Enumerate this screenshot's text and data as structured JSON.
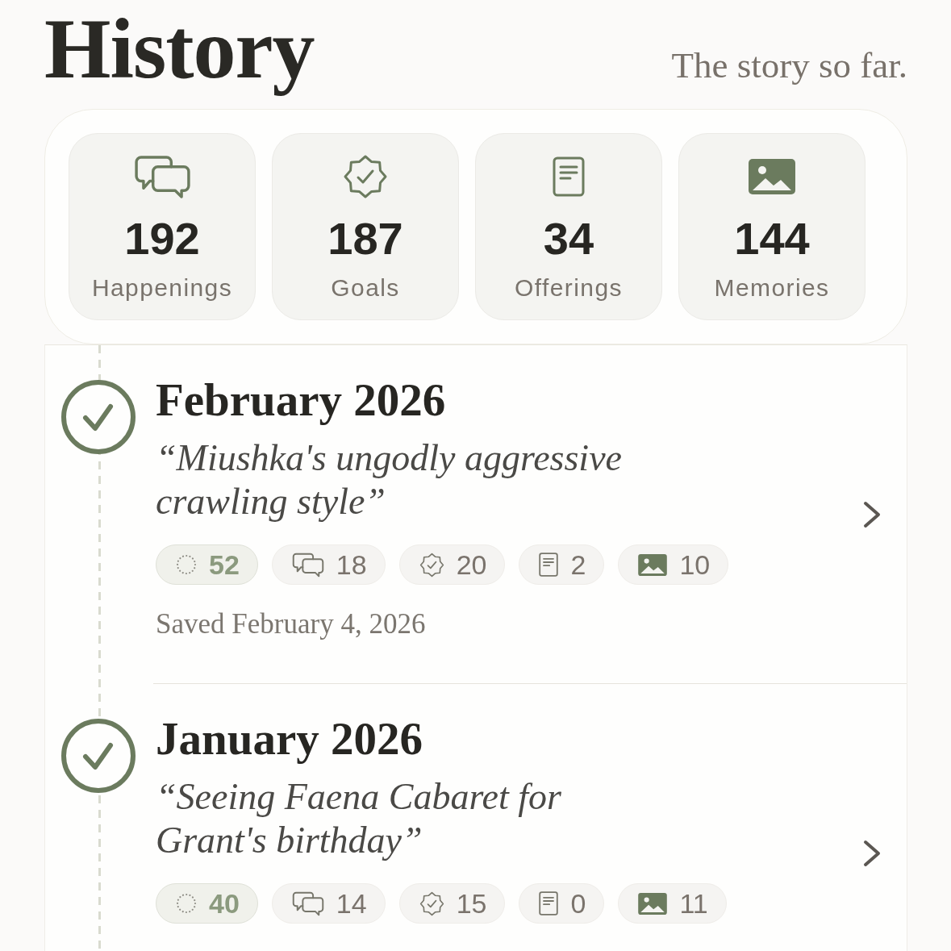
{
  "header": {
    "title": "History",
    "subtitle": "The story so far."
  },
  "stats": [
    {
      "kind": "chat",
      "value": "192",
      "label": "Happenings"
    },
    {
      "kind": "badge",
      "value": "187",
      "label": "Goals"
    },
    {
      "kind": "note",
      "value": "34",
      "label": "Offerings"
    },
    {
      "kind": "photo",
      "value": "144",
      "label": "Memories"
    }
  ],
  "entries": [
    {
      "title": "February 2026",
      "quote": "“Miushka's ungodly aggressive crawling style”",
      "completed": true,
      "counts": [
        {
          "kind": "ring",
          "value": "52"
        },
        {
          "kind": "chat",
          "value": "18"
        },
        {
          "kind": "badge",
          "value": "20"
        },
        {
          "kind": "note",
          "value": "2"
        },
        {
          "kind": "photo",
          "value": "10"
        }
      ],
      "saved": "Saved February 4, 2026"
    },
    {
      "title": "January 2026",
      "quote": "“Seeing Faena Cabaret for Grant's birthday”",
      "completed": true,
      "counts": [
        {
          "kind": "ring",
          "value": "40"
        },
        {
          "kind": "chat",
          "value": "14"
        },
        {
          "kind": "badge",
          "value": "15"
        },
        {
          "kind": "note",
          "value": "0"
        },
        {
          "kind": "photo",
          "value": "11"
        }
      ]
    }
  ]
}
